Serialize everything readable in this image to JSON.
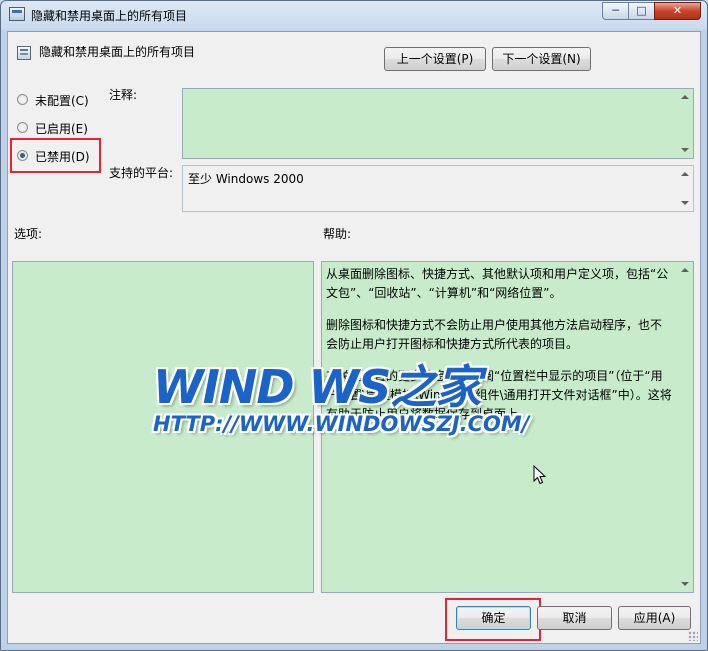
{
  "window": {
    "title": "隐藏和禁用桌面上的所有项目",
    "controls": {
      "minimize": "─",
      "maximize": "□",
      "close": "✕"
    }
  },
  "header": {
    "setting_name": "隐藏和禁用桌面上的所有项目",
    "prev_button": "上一个设置(P)",
    "next_button": "下一个设置(N)"
  },
  "state": {
    "options": [
      {
        "label": "未配置(C)",
        "selected": false
      },
      {
        "label": "已启用(E)",
        "selected": false
      },
      {
        "label": "已禁用(D)",
        "selected": true
      }
    ]
  },
  "comment": {
    "label": "注释:",
    "value": ""
  },
  "platform": {
    "label": "支持的平台:",
    "value": "至少 Windows 2000"
  },
  "options_section": {
    "label": "选项:"
  },
  "help_section": {
    "label": "帮助:",
    "paragraphs": [
      "从桌面删除图标、快捷方式、其他默认项和用户定义项，包括“公文包”、“回收站”、“计算机”和“网络位置”。",
      "删除图标和快捷方式不会防止用户使用其他方法启动程序，也不会防止用户打开图标和快捷方式所代表的项目。",
      "有关此设置的更多信息，请参阅“位置栏中显示的项目”（位于“用户配置\\管理模板\\Windows 组件\\通用打开文件对话框”中）。这将有助于防止用户将数据保存到桌面上。"
    ]
  },
  "footer": {
    "ok_button": "确定",
    "cancel_button": "取消",
    "apply_button": "应用(A)"
  },
  "watermark": {
    "logo": "WIND WS之家",
    "url": "HTTP://WWW.WINDOWSZJ.COM/"
  },
  "colors": {
    "highlight_red": "#e8232e",
    "pane_green": "#c8eccb",
    "logo_blue": "#1b63c6"
  }
}
